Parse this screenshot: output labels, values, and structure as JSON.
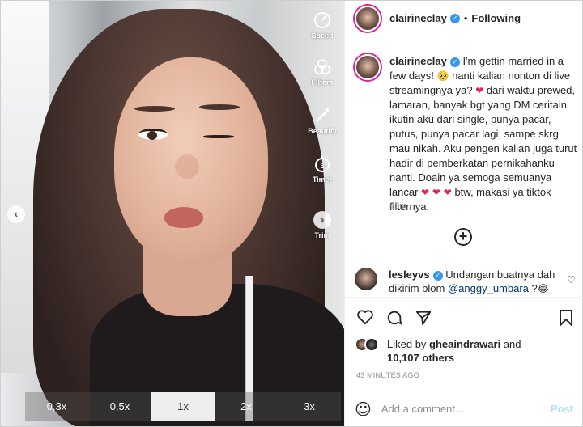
{
  "media": {
    "tools": [
      {
        "label": "Speed",
        "icon": "speedometer-icon"
      },
      {
        "label": "Filters",
        "icon": "filters-icon"
      },
      {
        "label": "Beautify",
        "icon": "magic-wand-icon"
      },
      {
        "label": "Timer",
        "icon": "timer-icon"
      },
      {
        "label": "Trim",
        "icon": "trim-icon"
      }
    ],
    "prev_arrow": "‹",
    "next_arrow": "›",
    "zoom_options": [
      "0,3x",
      "0,5x",
      "1x",
      "2x",
      "3x"
    ],
    "zoom_selected": "1x"
  },
  "header": {
    "username": "clairineclay",
    "separator": "•",
    "following_label": "Following"
  },
  "caption": {
    "username": "clairineclay",
    "line1": " I'm gettin married in a few days! ",
    "emoji1": "🥺",
    "line2": " nanti kalian nonton di live streamingnya ya? ",
    "heart1": "❤",
    "line3": " dari waktu prewed, lamaran, banyak bgt yang DM ceritain ikutin aku dari single, punya pacar, putus, punya pacar lagi, sampe skrg mau nikah. Aku pengen kalian juga turut hadir di pemberkatan pernikahanku nanti. Doain ya semoga semuanya lancar ",
    "hearts": "❤ ❤ ❤",
    "line4": " btw, makasi ya tiktok filternya.",
    "time": "43m"
  },
  "comment": {
    "username": "lesleyvs",
    "text": " Undangan buatnya dah dikirim blom ",
    "mention": "@anggy_umbara",
    "tail": " ?",
    "emoji": "😂",
    "heart": "♡"
  },
  "likes": {
    "prefix": "Liked by ",
    "user": "gheaindrawari",
    "mid": " and",
    "count": "10,107 others"
  },
  "timestamp": "43 MINUTES AGO",
  "add_comment": {
    "placeholder": "Add a comment...",
    "post_label": "Post",
    "emoji": "☺"
  },
  "colors": {
    "verified": "#3897f0",
    "post_disabled": "#b2dffc",
    "heart": "#e0245e",
    "mention": "#00376b"
  }
}
